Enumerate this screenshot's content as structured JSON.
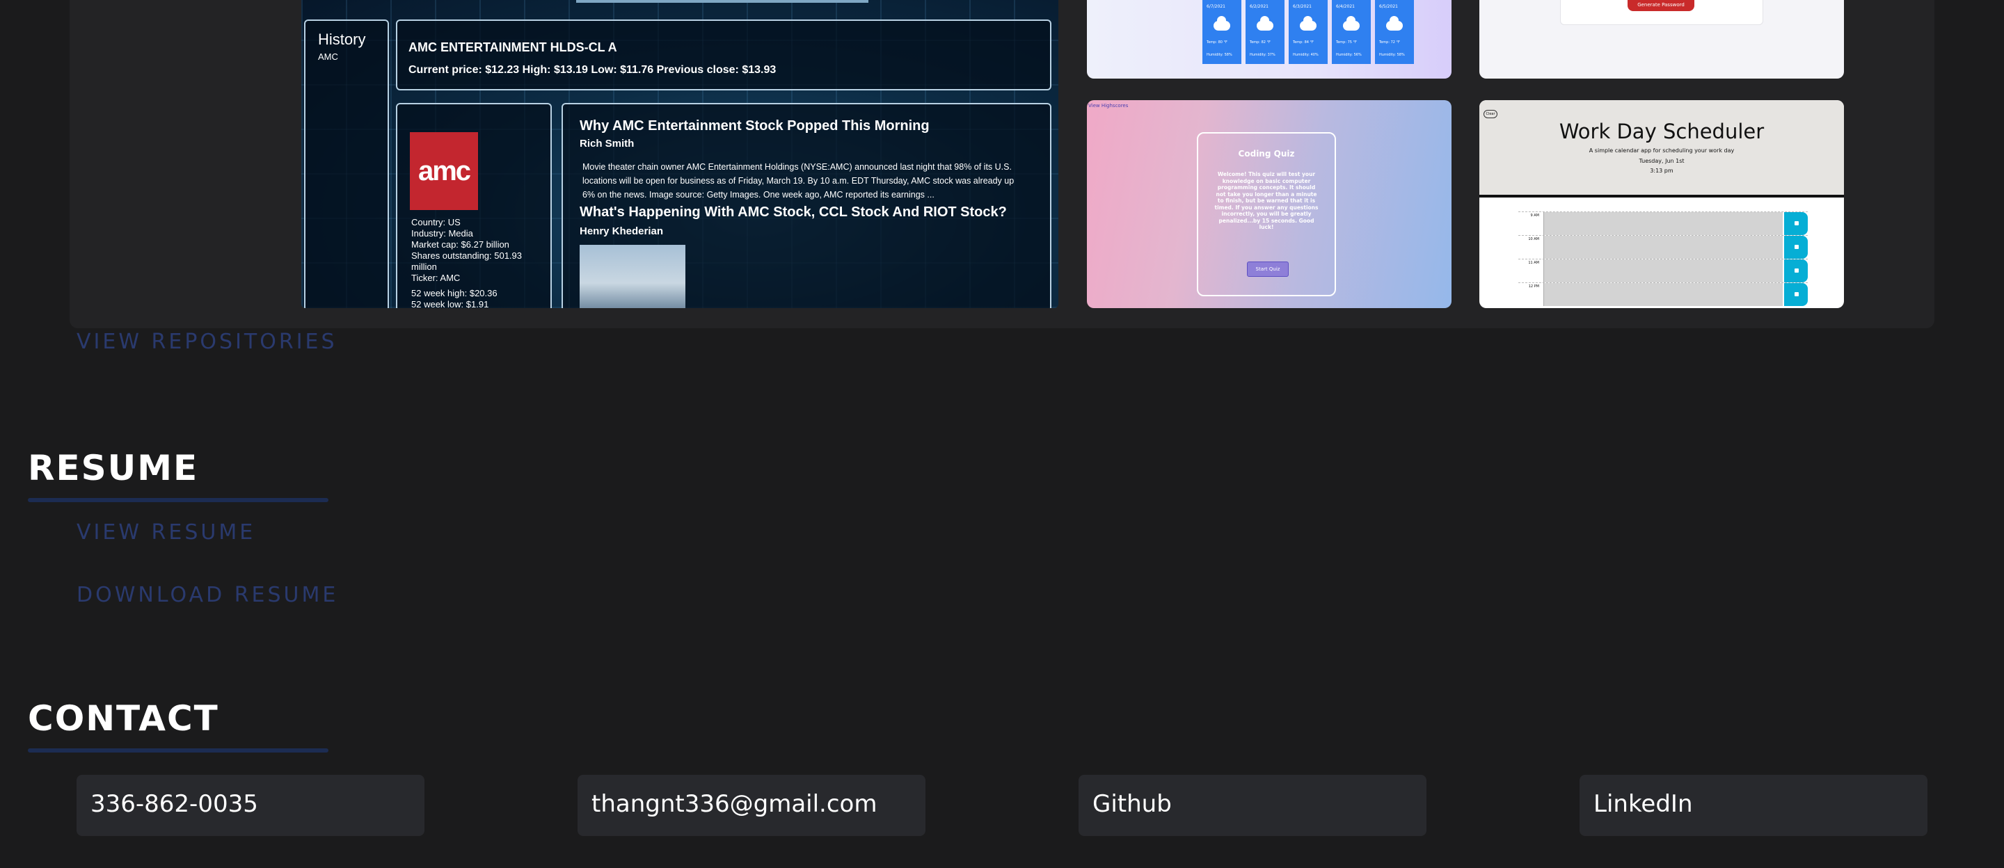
{
  "projects": {
    "amc": {
      "history_title": "History",
      "history_item": "AMC",
      "company_name": "AMC ENTERTAINMENT HLDS-CL A",
      "price_line": "Current price: $12.23 High: $13.19 Low: $11.76 Previous close: $13.93",
      "logo_text": "amc",
      "country": "Country: US",
      "industry": "Industry: Media",
      "market_cap": "Market cap: $6.27 billion",
      "shares": "Shares outstanding: 501.93 million",
      "ticker": "Ticker: AMC",
      "week_high": "52 week high: $20.36",
      "week_low": "52 week low: $1.91",
      "news": [
        {
          "headline": "Why AMC Entertainment Stock Popped This Morning",
          "author": "Rich Smith",
          "summary": "Movie theater chain owner AMC Entertainment Holdings (NYSE:AMC) announced last night that 98% of its U.S. locations will be open for business as of Friday, March 19. By 10 a.m. EDT Thursday, AMC stock was already up 6% on the news. Image source: Getty Images. One week ago, AMC reported its earnings ..."
        },
        {
          "headline": "What's Happening With AMC Stock, CCL Stock And RIOT Stock?",
          "author": "Henry Khederian"
        }
      ]
    },
    "weather": {
      "forecast": [
        {
          "date": "6/7/2021",
          "temp": "Temp: 80 °F",
          "humidity": "Humidity: 58%"
        },
        {
          "date": "6/2/2021",
          "temp": "Temp: 82 °F",
          "humidity": "Humidity: 37%"
        },
        {
          "date": "6/3/2021",
          "temp": "Temp: 84 °F",
          "humidity": "Humidity: 40%"
        },
        {
          "date": "6/4/2021",
          "temp": "Temp: 75 °F",
          "humidity": "Humidity: 56%"
        },
        {
          "date": "6/5/2021",
          "temp": "Temp: 72 °F",
          "humidity": "Humidity: 58%"
        }
      ]
    },
    "password": {
      "button": "Generate Password"
    },
    "quiz": {
      "highscores_link": "View Highscores",
      "title": "Coding Quiz",
      "text": "Welcome! This quiz will test your knowledge on basic computer programming concepts. It should not take you longer than a minute to finish, but be warned that it is timed. If you answer any questions incorrectly, you will be greatly penalized...by 15 seconds. Good luck!",
      "start_button": "Start Quiz"
    },
    "scheduler": {
      "clear_button": "Clear",
      "title": "Work Day Scheduler",
      "subtitle": "A simple calendar app for scheduling your work day",
      "date": "Tuesday, Jun 1st",
      "time": "3:13 pm",
      "hours": [
        "9 AM",
        "10 AM",
        "11 AM",
        "12 PM"
      ]
    }
  },
  "view_repositories": "VIEW REPOSITORIES",
  "resume": {
    "heading": "RESUME",
    "view": "VIEW RESUME",
    "download": "DOWNLOAD RESUME"
  },
  "contact": {
    "heading": "CONTACT",
    "phone": "336-862-0035",
    "email": "thangnt336@gmail.com",
    "github": "Github",
    "linkedin": "LinkedIn"
  },
  "colors": {
    "background": "#1b1b1c",
    "panel": "#232325",
    "link": "#2a3a6e",
    "rule": "#1c2c52",
    "contact_card": "#28292d"
  }
}
